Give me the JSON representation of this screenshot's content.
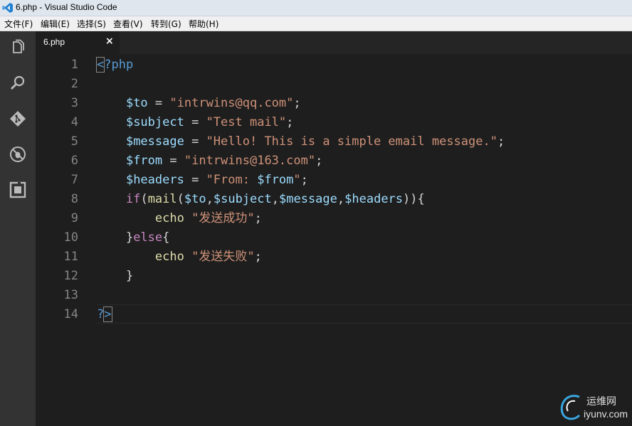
{
  "window": {
    "title": "6.php - Visual Studio Code",
    "ghost_tabs": [
      "...",
      "..."
    ]
  },
  "menu": {
    "items": [
      "文件(F)",
      "编辑(E)",
      "选择(S)",
      "查看(V)",
      "转到(G)",
      "帮助(H)"
    ]
  },
  "activity_bar": {
    "icons": [
      "explorer-icon",
      "search-icon",
      "git-icon",
      "debug-icon",
      "extensions-icon"
    ]
  },
  "tabs": [
    {
      "label": "6.php",
      "close": "×",
      "active": true
    }
  ],
  "editor": {
    "language": "php",
    "line_numbers": [
      "1",
      "2",
      "3",
      "4",
      "5",
      "6",
      "7",
      "8",
      "9",
      "10",
      "11",
      "12",
      "13",
      "14"
    ]
  },
  "watermark": {
    "cn": "运维网",
    "url": "iyunv.com"
  },
  "colors": {
    "keyword": "#c586c0",
    "variable": "#9cdcfe",
    "string": "#ce9178",
    "tag": "#569cd6",
    "function": "#dcdcaa"
  }
}
